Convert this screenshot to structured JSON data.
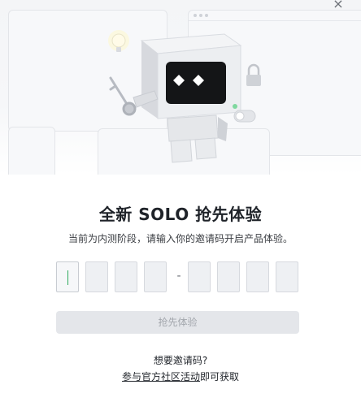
{
  "dialog": {
    "close_symbol": "×"
  },
  "hero": {
    "illustration": "robot-with-key-and-lock",
    "icons": [
      "lightbulb-icon",
      "key-icon",
      "lock-icon",
      "toggle-switch-icon"
    ]
  },
  "title": "全新 SOLO 抢先体验",
  "subtitle": "当前为内测阶段，请输入你的邀请码开启产品体验。",
  "invite_code": {
    "first_group": [
      "",
      "",
      "",
      ""
    ],
    "separator": "-",
    "second_group": [
      "",
      "",
      "",
      ""
    ],
    "active_index": 0,
    "caret_color": "#2eaa5c"
  },
  "submit": {
    "label": "抢先体验",
    "enabled": false
  },
  "footer": {
    "question": "想要邀请码?",
    "link_text": "参与官方社区活动",
    "suffix": "即可获取"
  },
  "colors": {
    "title": "#1f2329",
    "button_bg_disabled": "#e4e6ea",
    "button_text_disabled": "#a3a7ad",
    "accent_caret": "#2eaa5c"
  }
}
